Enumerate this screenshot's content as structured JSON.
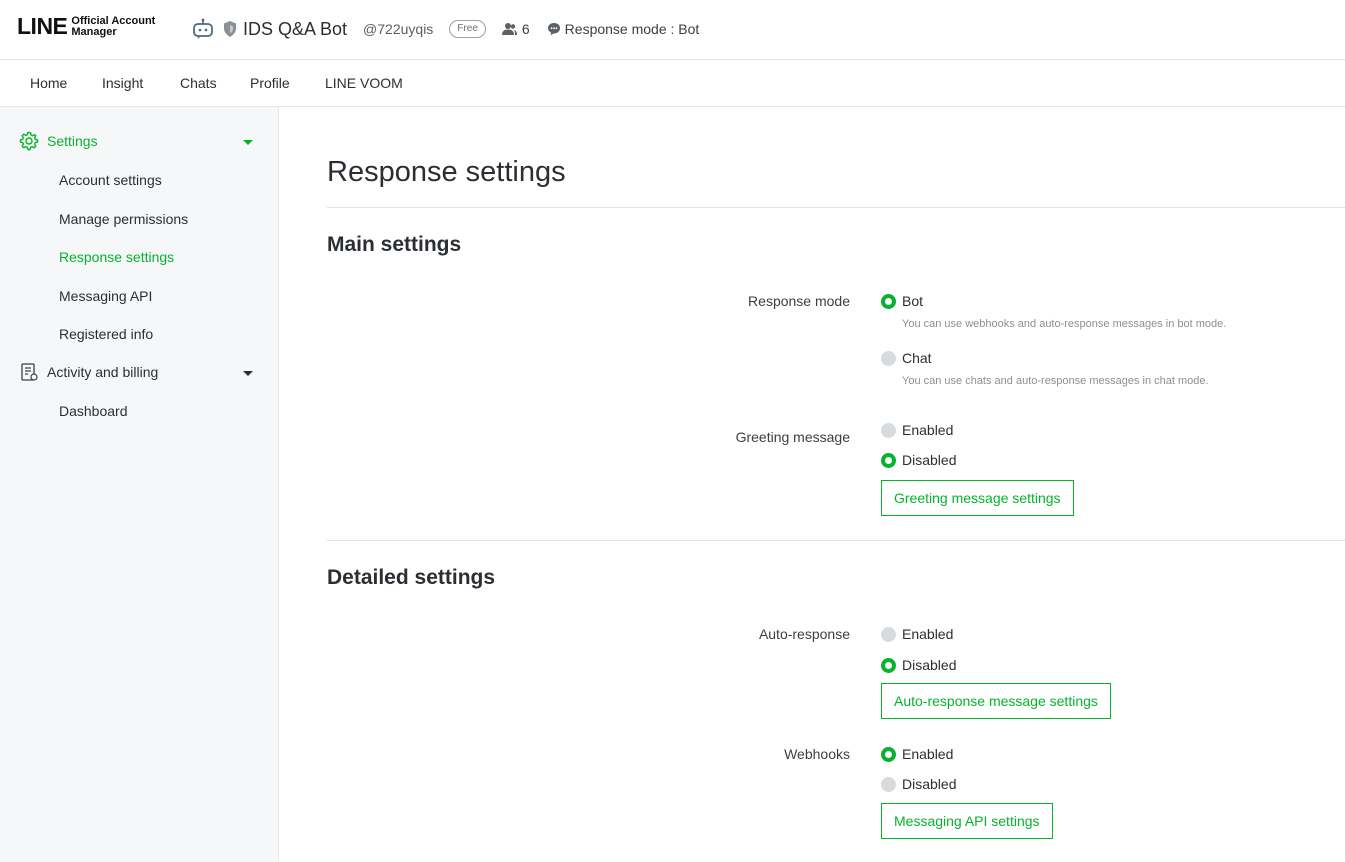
{
  "brand": {
    "logo_main": "LINE",
    "logo_sub_1": "Official Account",
    "logo_sub_2": "Manager",
    "accent": "#06b42c"
  },
  "account": {
    "name": "IDS Q&A Bot",
    "id": "@722uyqis",
    "plan_badge": "Free",
    "friends_count": "6",
    "response_mode": "Response mode : Bot"
  },
  "nav": {
    "items": [
      "Home",
      "Insight",
      "Chats",
      "Profile",
      "LINE VOOM"
    ]
  },
  "sidebar": {
    "settings_label": "Settings",
    "settings_items": [
      "Account settings",
      "Manage permissions",
      "Response settings",
      "Messaging API",
      "Registered info"
    ],
    "activity_label": "Activity and billing",
    "activity_items": [
      "Dashboard"
    ]
  },
  "main": {
    "title": "Response settings",
    "main_settings": {
      "title": "Main settings",
      "response_mode": {
        "label": "Response mode",
        "bot": "Bot",
        "bot_hint": "You can use webhooks and auto-response messages in bot mode.",
        "chat": "Chat",
        "chat_hint": "You can use chats and auto-response messages in chat mode.",
        "selected": "Bot"
      },
      "greeting": {
        "label": "Greeting message",
        "enabled": "Enabled",
        "disabled": "Disabled",
        "selected": "Disabled",
        "button": "Greeting message settings"
      }
    },
    "detailed_settings": {
      "title": "Detailed settings",
      "auto_response": {
        "label": "Auto-response",
        "enabled": "Enabled",
        "disabled": "Disabled",
        "selected": "Disabled",
        "button": "Auto-response message settings"
      },
      "webhooks": {
        "label": "Webhooks",
        "enabled": "Enabled",
        "disabled": "Disabled",
        "selected": "Enabled",
        "button": "Messaging API settings"
      }
    }
  }
}
